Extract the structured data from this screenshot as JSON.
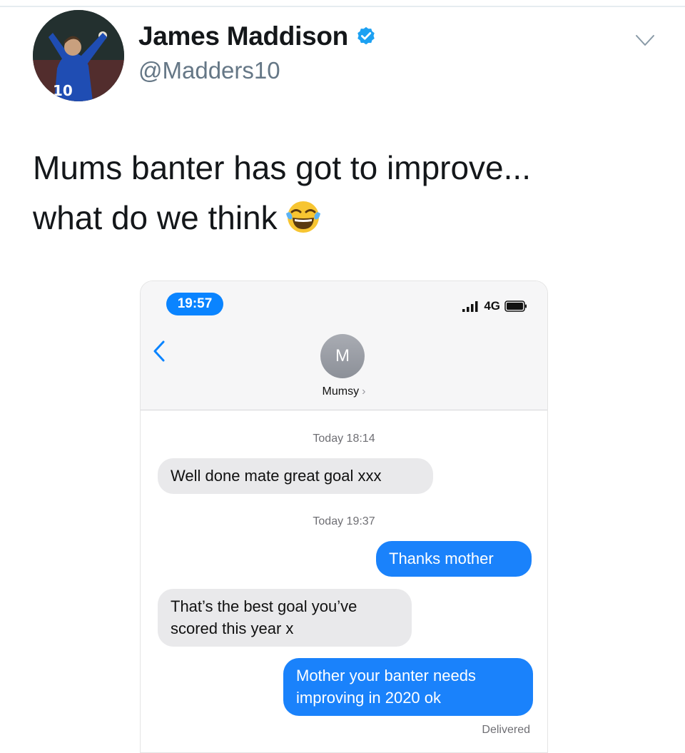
{
  "tweet": {
    "display_name": "James Maddison",
    "handle": "@Madders10",
    "text_line1": "Mums banter has got to improve...",
    "text_line2": "what do we think",
    "emoji": "face-with-tears-of-joy",
    "verified": true
  },
  "phone": {
    "status_time": "19:57",
    "network": "4G",
    "contact": {
      "initial": "M",
      "name": "Mumsy",
      "chevron": "›"
    },
    "messages": [
      {
        "type": "timestamp",
        "text": "Today 18:14"
      },
      {
        "type": "incoming",
        "text": "Well done mate great goal xxx"
      },
      {
        "type": "timestamp",
        "text": "Today 19:37"
      },
      {
        "type": "outgoing",
        "text": "Thanks mother"
      },
      {
        "type": "incoming",
        "line1": "That’s the best goal you’ve",
        "line2": "scored this year x"
      },
      {
        "type": "outgoing",
        "line1": "Mother your banter needs",
        "line2": "improving in 2020 ok"
      }
    ],
    "delivered_label": "Delivered"
  },
  "colors": {
    "accent": "#1da1f2",
    "imessage_blue": "#1a82fb",
    "incoming_gray": "#e9e9eb",
    "status_pill": "#0a84ff"
  }
}
